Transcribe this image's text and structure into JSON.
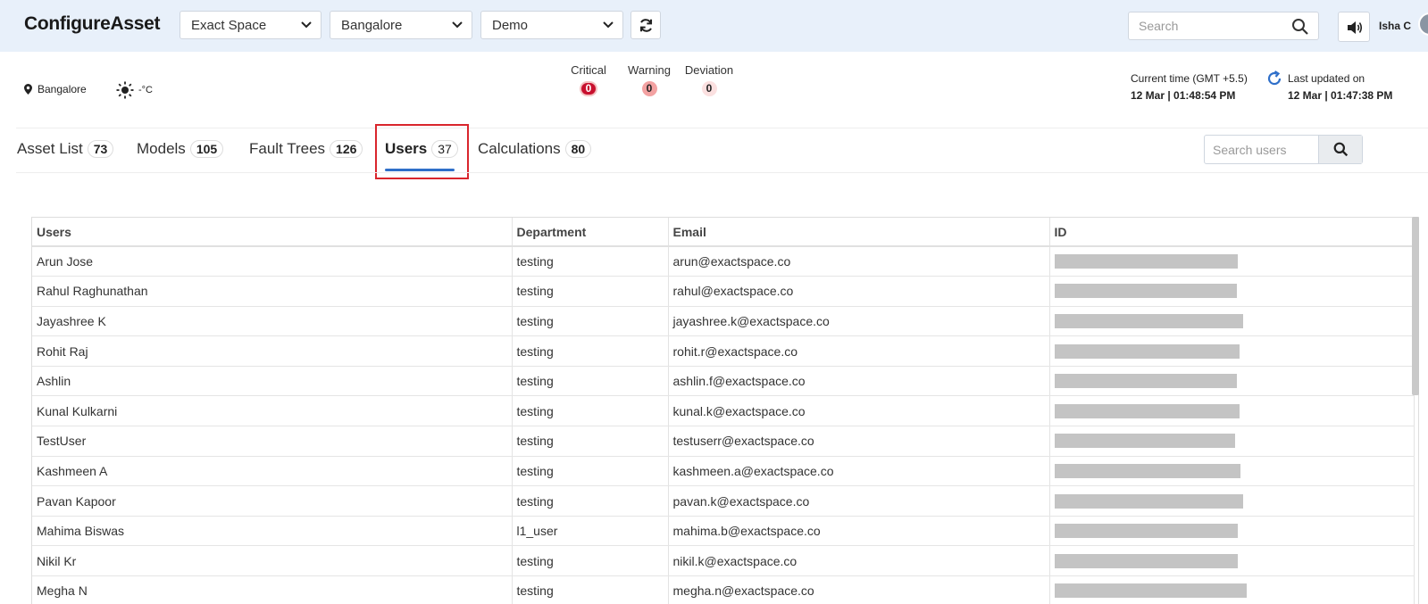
{
  "app": {
    "title": "ConfigureAsset"
  },
  "header": {
    "selects": [
      "Exact Space",
      "Bangalore",
      "Demo"
    ],
    "search_placeholder": "Search",
    "user_name": "Isha C"
  },
  "info": {
    "location": "Bangalore",
    "temperature": "-°C",
    "alarms": {
      "critical_label": "Critical",
      "critical_count": "0",
      "warning_label": "Warning",
      "warning_count": "0",
      "deviation_label": "Deviation",
      "deviation_count": "0"
    },
    "current_time_label": "Current time (GMT +5.5)",
    "current_time_value": "12 Mar | 01:48:54 PM",
    "last_updated_label": "Last updated on",
    "last_updated_value": "12 Mar | 01:47:38 PM"
  },
  "tabs": [
    {
      "label": "Asset List",
      "count": "73"
    },
    {
      "label": "Models",
      "count": "105"
    },
    {
      "label": "Fault Trees",
      "count": "126"
    },
    {
      "label": "Users",
      "count": "37"
    },
    {
      "label": "Calculations",
      "count": "80"
    }
  ],
  "users_search_placeholder": "Search users",
  "table": {
    "headers": [
      "Users",
      "Department",
      "Email",
      "ID"
    ],
    "rows": [
      {
        "name": "Arun Jose",
        "dept": "testing",
        "email": "arun@exactspace.co"
      },
      {
        "name": "Rahul Raghunathan",
        "dept": "testing",
        "email": "rahul@exactspace.co"
      },
      {
        "name": "Jayashree K",
        "dept": "testing",
        "email": "jayashree.k@exactspace.co"
      },
      {
        "name": "Rohit Raj",
        "dept": "testing",
        "email": "rohit.r@exactspace.co"
      },
      {
        "name": "Ashlin",
        "dept": "testing",
        "email": "ashlin.f@exactspace.co"
      },
      {
        "name": "Kunal Kulkarni",
        "dept": "testing",
        "email": "kunal.k@exactspace.co"
      },
      {
        "name": "TestUser",
        "dept": "testing",
        "email": "testuserr@exactspace.co"
      },
      {
        "name": "Kashmeen A",
        "dept": "testing",
        "email": "kashmeen.a@exactspace.co"
      },
      {
        "name": "Pavan Kapoor",
        "dept": "testing",
        "email": "pavan.k@exactspace.co"
      },
      {
        "name": "Mahima Biswas",
        "dept": "l1_user",
        "email": "mahima.b@exactspace.co"
      },
      {
        "name": "Nikil Kr",
        "dept": "testing",
        "email": "nikil.k@exactspace.co"
      },
      {
        "name": "Megha N",
        "dept": "testing",
        "email": "megha.n@exactspace.co"
      }
    ]
  }
}
